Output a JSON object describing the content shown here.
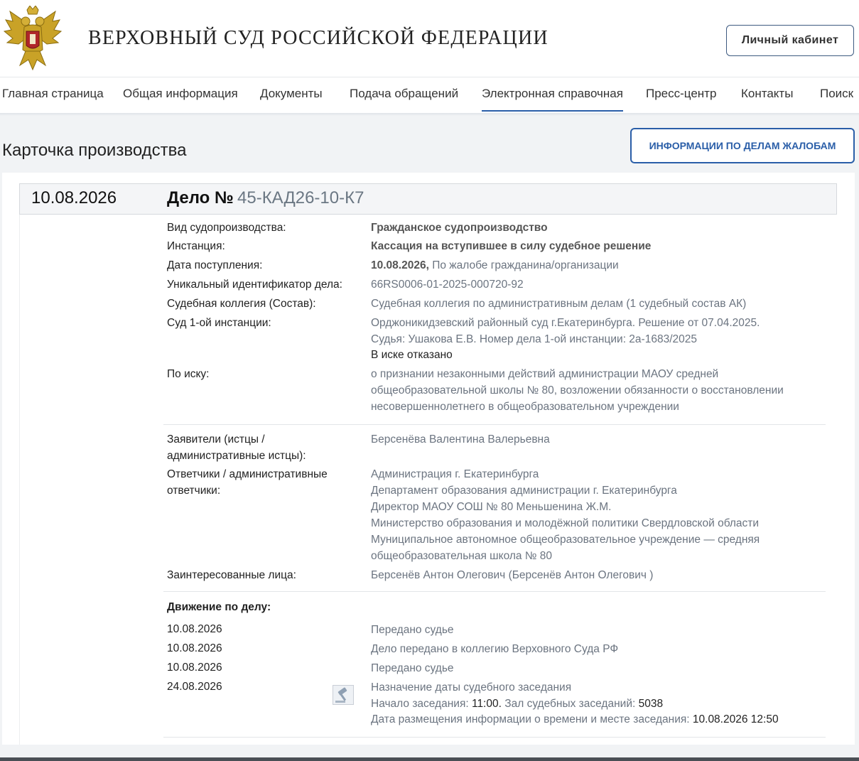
{
  "header": {
    "site_title": "ВЕРХОВНЫЙ СУД РОССИЙСКОЙ ФЕДЕРАЦИИ",
    "cabinet_button": "Личный кабинет"
  },
  "nav": {
    "items": [
      {
        "label": "Главная страница"
      },
      {
        "label": "Общая информация"
      },
      {
        "label": "Документы"
      },
      {
        "label": "Подача обращений"
      },
      {
        "label": "Электронная справочная",
        "active": true
      },
      {
        "label": "Пресс-центр"
      },
      {
        "label": "Контакты"
      },
      {
        "label": "Поиск"
      }
    ]
  },
  "page": {
    "title": "Карточка производства",
    "complaints_button": "ИНФОРМАЦИИ ПО ДЕЛАМ ЖАЛОБАМ"
  },
  "case": {
    "date": "10.08.2026",
    "case_label": "Дело №",
    "case_number": "45-КАД26-10-К7",
    "fields": {
      "proceeding_type": {
        "label": "Вид судопроизводства:",
        "value": "Гражданское судопроизводство"
      },
      "instance": {
        "label": "Инстанция:",
        "value": "Кассация на вступившее в силу судебное решение"
      },
      "receipt_date": {
        "label": "Дата поступления:",
        "date": "10.08.2026,",
        "value": " По жалобе гражданина/организации"
      },
      "uid": {
        "label": "Уникальный идентификатор дела:",
        "value": "66RS0006-01-2025-000720-92"
      },
      "collegium": {
        "label": "Судебная коллегия (Состав):",
        "value": "Судебная коллегия по административным делам  (1 судебный состав АК)"
      },
      "first_instance": {
        "label": "Суд 1-ой инстанции:",
        "line1": "Орджоникидзевский районный суд г.Екатеринбурга. Решение от 07.04.2025.",
        "line2": "Судья: Ушакова Е.В. Номер дела 1-ой инстанции: 2а-1683/2025",
        "line3": "В иске отказано"
      },
      "claim": {
        "label": "По иску:",
        "line1": "о признании незаконными действий администрации МАОУ средней",
        "line2": "общеобразовательной школы № 80, возложении обязанности о восстановлении",
        "line3": "несовершеннолетнего в общеобразовательном учреждении"
      }
    },
    "parties": {
      "plaintiffs_label_1": "Заявители (истцы /",
      "plaintiffs_label_2": "административные истцы):",
      "plaintiffs": [
        "Берсенёва Валентина Валерьевна"
      ],
      "defendants_label_1": "Ответчики / административные",
      "defendants_label_2": "ответчики:",
      "defendants": [
        "Администрация г. Екатеринбурга",
        "Департамент образования администрации г. Екатеринбурга",
        "Директор МАОУ СОШ № 80 Меньшенина Ж.М.",
        "Министерство образования и молодёжной политики Свердловской области",
        "Муниципальное автономное общеобразовательное учреждение — средняя",
        "общеобразовательная школа № 80"
      ],
      "interested_label": "Заинтересованные лица:",
      "interested": "Берсенёв Антон Олегович  (Берсенёв Антон Олегович )"
    },
    "movement": {
      "title": "Движение по делу:",
      "events": [
        {
          "date": "10.08.2026",
          "text": "Передано судье"
        },
        {
          "date": "10.08.2026",
          "text": "Дело передано в коллегию Верховного Суда РФ"
        },
        {
          "date": "10.08.2026",
          "text": "Передано судье"
        },
        {
          "date": "24.08.2026",
          "text": "Назначение даты судебного заседания",
          "start_label": "Начало заседания:",
          "start_value": "11:00.",
          "hall_label": "Зал судебных заседаний:",
          "hall_value": "5038",
          "posted_label": "Дата размещения информации о времени и месте заседания:",
          "posted_value": "10.08.2026 12:50",
          "icon": "gavel-icon"
        }
      ]
    }
  },
  "colors": {
    "accent": "#2a5ea8",
    "muted_text": "#6b7480",
    "page_bg": "#f1f3f5"
  }
}
